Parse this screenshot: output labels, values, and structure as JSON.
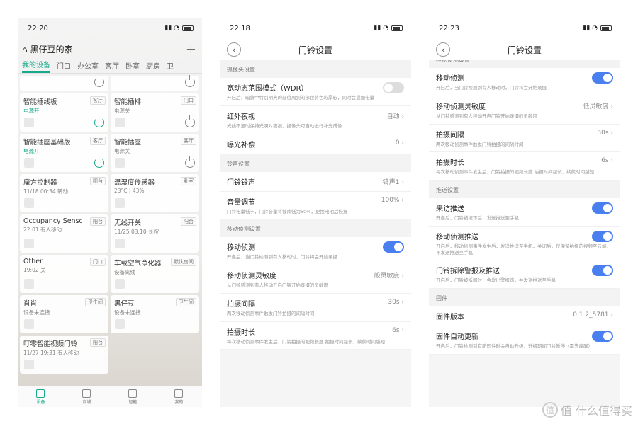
{
  "phone1": {
    "time": "22:20",
    "home_title": "黑仔豆的家",
    "add": "+",
    "tabs": [
      "我的设备",
      "门口",
      "办公室",
      "客厅",
      "卧室",
      "厨房",
      "卫"
    ],
    "devices": [
      {
        "name": "",
        "room": "",
        "status": ""
      },
      {
        "name": "",
        "room": "",
        "status": ""
      },
      {
        "name": "智能插线板",
        "room": "客厅",
        "status": "电源开",
        "on": true
      },
      {
        "name": "智能插排",
        "room": "门口",
        "status": "电源关",
        "on": false
      },
      {
        "name": "智能插座基础版",
        "room": "客厅",
        "status": "电源开",
        "on": true
      },
      {
        "name": "智能插座",
        "room": "客厅",
        "status": "电源关",
        "on": false
      },
      {
        "name": "魔方控制器",
        "room": "阳台",
        "status": "11/18 00:34 转动"
      },
      {
        "name": "温湿度传感器",
        "room": "卧室",
        "status": "23°C | 43%"
      },
      {
        "name": "Occupancy Sensor",
        "room": "阳台",
        "status": "22:01 有人移动"
      },
      {
        "name": "无线开关",
        "room": "阳台",
        "status": "11/25 03:10 长按"
      },
      {
        "name": "Other",
        "room": "门口",
        "status": "19:02 关"
      },
      {
        "name": "车载空气净化器",
        "room": "默认房间",
        "status": "设备离线"
      },
      {
        "name": "肖肖",
        "room": "卫生间",
        "status": "设备未连接"
      },
      {
        "name": "黑仔豆",
        "room": "卫生间",
        "status": "设备未连接"
      },
      {
        "name": "叮零智能视频门铃",
        "room": "阳台",
        "status": "11/27 19:31 有人移动"
      }
    ],
    "bottom_nav": [
      "设备",
      "商城",
      "智能",
      "我的"
    ]
  },
  "phone2": {
    "time": "22:18",
    "title": "门铃设置",
    "sections": [
      {
        "header": "摄像头设置",
        "rows": [
          {
            "label": "宽动态范围模式（WDR）",
            "desc": "开启后，暗黄中特别明亮的部位周到的部位将色彩厚彩，同时会提加电量",
            "toggle": "off"
          },
          {
            "label": "红外夜视",
            "value": "自动",
            "desc": "光线不足时保持光照对夜视，摄像头可自动进行补光成像"
          },
          {
            "label": "曝光补偿",
            "value": "0"
          }
        ]
      },
      {
        "header": "铃声设置",
        "rows": [
          {
            "label": "门铃铃声",
            "value": "铃声1"
          },
          {
            "label": "音量调节",
            "value": "100%",
            "desc": "门铃电量低于，门铃音量将被降低为50%，更换电池后恢复"
          }
        ]
      },
      {
        "header": "移动侦测设置",
        "rows": [
          {
            "label": "移动侦测",
            "desc": "开启后，当门铃检测到有人移动时，门铃将会开始录摄",
            "toggle": "on"
          },
          {
            "label": "移动侦测灵敏度",
            "value": "一般灵敏度",
            "desc": "从门铃感测到有人移动开启门铃开始录摄的灵敏度"
          },
          {
            "label": "拍摄间隔",
            "value": "30s",
            "desc": "两次移动侦测事件触发门铃拍摄的间隔时间"
          },
          {
            "label": "拍摄时长",
            "value": "6s",
            "desc": "每次移动侦测事件发生后，门铃拍摄的视频长度 拍摄时间越长，续航时间越短"
          }
        ]
      }
    ]
  },
  "phone3": {
    "time": "22:23",
    "title": "门铃设置",
    "sections": [
      {
        "header": "移动侦测设置",
        "rows": [
          {
            "label": "移动侦测",
            "desc": "开启后，当门铃检测到有人移动时，门铃将会开始录摄",
            "toggle": "on"
          },
          {
            "label": "移动侦测灵敏度",
            "value": "低灵敏度",
            "desc": "从门铃感测到有人移动开启门铃开始录摄的灵敏度"
          },
          {
            "label": "拍摄间隔",
            "value": "30s",
            "desc": "两次移动侦测事件触发门铃拍摄的间隔时间"
          },
          {
            "label": "拍摄时长",
            "value": "6s",
            "desc": "每次移动侦测事件发生后，门铃拍摄的视频长度 拍摄时间越长，续航时间越短"
          }
        ]
      },
      {
        "header": "推送设置",
        "rows": [
          {
            "label": "来访推送",
            "desc": "开启后，门铃被按下后，发送推送至手机",
            "toggle": "on"
          },
          {
            "label": "移动侦测推送",
            "desc": "开启后，移动侦测事件发生后，发送推送至手机，关闭后，仅保留拍摄的视频至云端，不发送推送至手机",
            "toggle": "on"
          },
          {
            "label": "门铃拆除警报及推送",
            "desc": "开启后，门铃被拆卸时，会发出警报声，并发送推送至手机",
            "toggle": "on"
          }
        ]
      },
      {
        "header": "固件",
        "rows": [
          {
            "label": "固件版本",
            "value": "0.1.2_5781"
          },
          {
            "label": "固件自动更新",
            "desc": "开启后，门铃检测到有新固件时会自动升级，升级期间门铃暂停（需先唤醒）",
            "toggle": "on"
          }
        ]
      }
    ]
  },
  "watermark": "值 什么值得买"
}
